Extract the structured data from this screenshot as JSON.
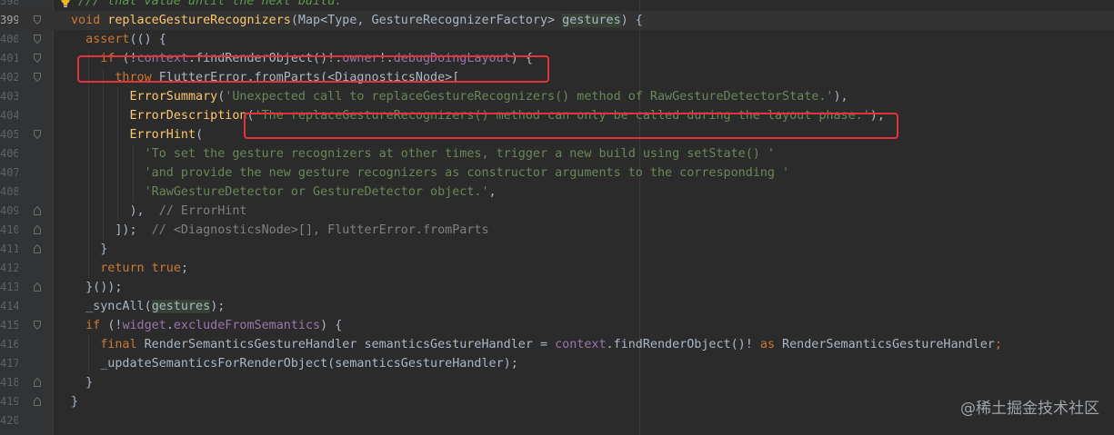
{
  "lines": [
    {
      "n": "398",
      "tokens": [
        [
          "t-doc",
          "/// that value until the next build."
        ]
      ]
    },
    {
      "n": "399",
      "current": true,
      "tokens": [
        [
          "t-kw",
          "void "
        ],
        [
          "t-fn",
          "replaceGestureRecognizers"
        ],
        [
          "t-cls",
          "(Map<Type, GestureRecognizerFactory> "
        ],
        [
          "t-hl",
          "gestures"
        ],
        [
          "t-cls",
          ") {"
        ]
      ]
    },
    {
      "n": "400",
      "tokens": [
        [
          "t-cls",
          "  "
        ],
        [
          "t-kw",
          "assert"
        ],
        [
          "t-cls",
          "(() {"
        ]
      ]
    },
    {
      "n": "401",
      "tokens": [
        [
          "t-cls",
          "    "
        ],
        [
          "t-kw",
          "if "
        ],
        [
          "t-cls",
          "(!"
        ],
        [
          "t-pr",
          "context"
        ],
        [
          "t-cls",
          ".findRenderObject()!."
        ],
        [
          "t-pr",
          "owner"
        ],
        [
          "t-cls",
          "!."
        ],
        [
          "t-pr",
          "debugDoingLayout"
        ],
        [
          "t-cls",
          ") {"
        ]
      ]
    },
    {
      "n": "402",
      "tokens": [
        [
          "t-cls",
          "      "
        ],
        [
          "t-kw",
          "throw "
        ],
        [
          "t-cls",
          "FlutterError.fromParts(<DiagnosticsNode>["
        ]
      ]
    },
    {
      "n": "403",
      "tokens": [
        [
          "t-cls",
          "        "
        ],
        [
          "t-fn",
          "ErrorSummary"
        ],
        [
          "t-cls",
          "("
        ],
        [
          "t-str",
          "'Unexpected call to replaceGestureRecognizers() method of RawGestureDetectorState.'"
        ],
        [
          "t-cls",
          "),"
        ]
      ]
    },
    {
      "n": "404",
      "tokens": [
        [
          "t-cls",
          "        "
        ],
        [
          "t-fn",
          "ErrorDescription"
        ],
        [
          "t-cls",
          "("
        ],
        [
          "t-str",
          "'The replaceGestureRecognizers() method can only be called during the layout phase.'"
        ],
        [
          "t-cls",
          "),"
        ]
      ]
    },
    {
      "n": "405",
      "tokens": [
        [
          "t-cls",
          "        "
        ],
        [
          "t-fn",
          "ErrorHint"
        ],
        [
          "t-cls",
          "("
        ]
      ]
    },
    {
      "n": "406",
      "tokens": [
        [
          "t-cls",
          "          "
        ],
        [
          "t-str",
          "'To set the gesture recognizers at other times, trigger a new build using setState() '"
        ]
      ]
    },
    {
      "n": "407",
      "tokens": [
        [
          "t-cls",
          "          "
        ],
        [
          "t-str",
          "'and provide the new gesture recognizers as constructor arguments to the corresponding '"
        ]
      ]
    },
    {
      "n": "408",
      "tokens": [
        [
          "t-cls",
          "          "
        ],
        [
          "t-str",
          "'RawGestureDetector or GestureDetector object.'"
        ],
        [
          "t-cls",
          ","
        ]
      ]
    },
    {
      "n": "409",
      "tokens": [
        [
          "t-cls",
          "        ),  "
        ],
        [
          "t-cm",
          "// ErrorHint"
        ]
      ]
    },
    {
      "n": "410",
      "tokens": [
        [
          "t-cls",
          "      ]);  "
        ],
        [
          "t-cm",
          "// <DiagnosticsNode>[], FlutterError.fromParts"
        ]
      ]
    },
    {
      "n": "411",
      "tokens": [
        [
          "t-cls",
          "    }"
        ]
      ]
    },
    {
      "n": "412",
      "tokens": [
        [
          "t-cls",
          "    "
        ],
        [
          "t-kw",
          "return true"
        ],
        [
          "t-cls",
          ";"
        ]
      ]
    },
    {
      "n": "413",
      "tokens": [
        [
          "t-cls",
          "  }());"
        ]
      ]
    },
    {
      "n": "414",
      "tokens": [
        [
          "t-cls",
          "  _syncAll("
        ],
        [
          "t-hl",
          "gestures"
        ],
        [
          "t-cls",
          ");"
        ]
      ]
    },
    {
      "n": "415",
      "tokens": [
        [
          "t-cls",
          "  "
        ],
        [
          "t-kw",
          "if "
        ],
        [
          "t-cls",
          "(!"
        ],
        [
          "t-pr",
          "widget"
        ],
        [
          "t-cls",
          "."
        ],
        [
          "t-pr",
          "excludeFromSemantics"
        ],
        [
          "t-cls",
          ") {"
        ]
      ]
    },
    {
      "n": "416",
      "tokens": [
        [
          "t-cls",
          "    "
        ],
        [
          "t-kw",
          "final "
        ],
        [
          "t-cls",
          "RenderSemanticsGestureHandler semanticsGestureHandler = "
        ],
        [
          "t-pr",
          "context"
        ],
        [
          "t-cls",
          ".findRenderObject()! "
        ],
        [
          "t-kw",
          "as "
        ],
        [
          "t-cls",
          "RenderSemanticsGestureHandler"
        ],
        [
          "t-kw",
          ";"
        ]
      ]
    },
    {
      "n": "417",
      "tokens": [
        [
          "t-cls",
          "    _updateSemanticsForRenderObject(semanticsGestureHandler);"
        ]
      ]
    },
    {
      "n": "418",
      "tokens": [
        [
          "t-cls",
          "  }"
        ]
      ]
    },
    {
      "n": "419",
      "tokens": [
        [
          "t-cls",
          "}"
        ]
      ]
    },
    {
      "n": "420",
      "tokens": []
    }
  ],
  "watermark": "@稀土掘金技术社区",
  "colors": {
    "background": "#2b2b2b",
    "keyword": "#cc7832",
    "function": "#ffc66d",
    "string": "#6a8759",
    "property": "#9876aa",
    "annotation_box": "#e0333a"
  },
  "icons": [
    "lightbulb-icon",
    "fold-icon"
  ]
}
